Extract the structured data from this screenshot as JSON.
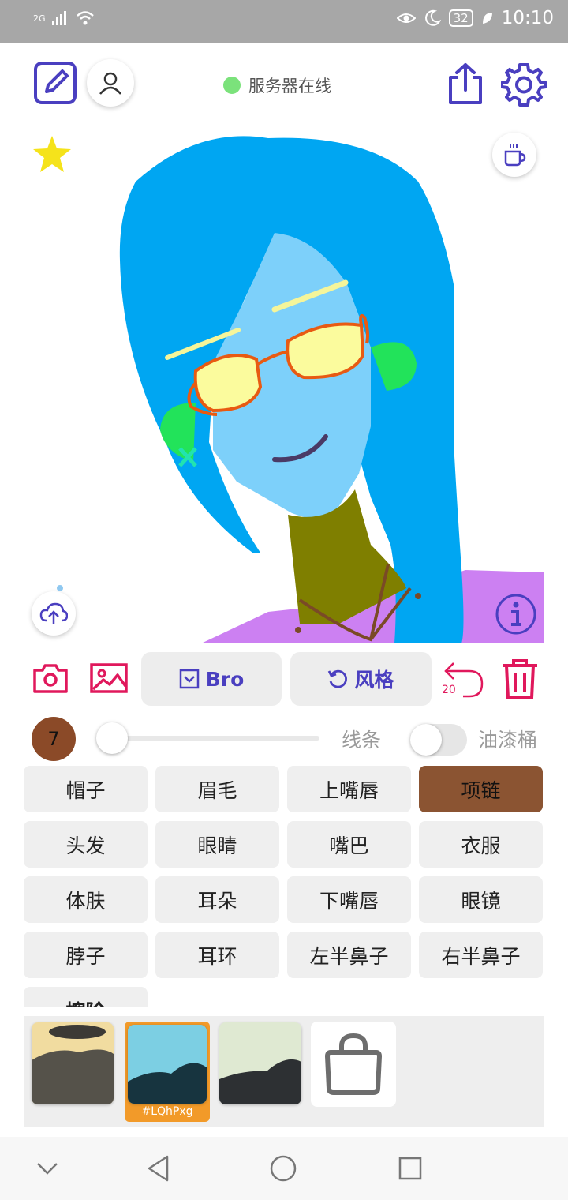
{
  "status_bar": {
    "network": "2G",
    "battery": "32",
    "time": "10:10"
  },
  "header": {
    "server_status": "服务器在线",
    "status_color": "#7be27b"
  },
  "canvas": {
    "background": "#ffffff",
    "icons": [
      "star-icon",
      "coffee-icon",
      "cloud-upload-icon",
      "info-icon"
    ]
  },
  "actions": {
    "bro_label": "Bro",
    "style_label": "风格",
    "undo_count": "20",
    "accent": "#e0185c",
    "brand": "#4a3fc0"
  },
  "line_tools": {
    "brush_size": "7",
    "brush_color": "#8b4a28",
    "line_label": "线条",
    "bucket_label": "油漆桶",
    "bucket_enabled": false
  },
  "parts": {
    "selected": "项链",
    "items": [
      "帽子",
      "眉毛",
      "上嘴唇",
      "项链",
      "头发",
      "眼睛",
      "嘴巴",
      "衣服",
      "体肤",
      "耳朵",
      "下嘴唇",
      "眼镜",
      "脖子",
      "耳环",
      "左半鼻子",
      "右半鼻子",
      "擦除"
    ]
  },
  "styles": {
    "selected_tag": "#LQhPxg",
    "count": 3
  },
  "nav": {
    "icons": [
      "back-chevron-icon",
      "back-triangle-icon",
      "home-circle-icon",
      "recents-square-icon"
    ]
  }
}
